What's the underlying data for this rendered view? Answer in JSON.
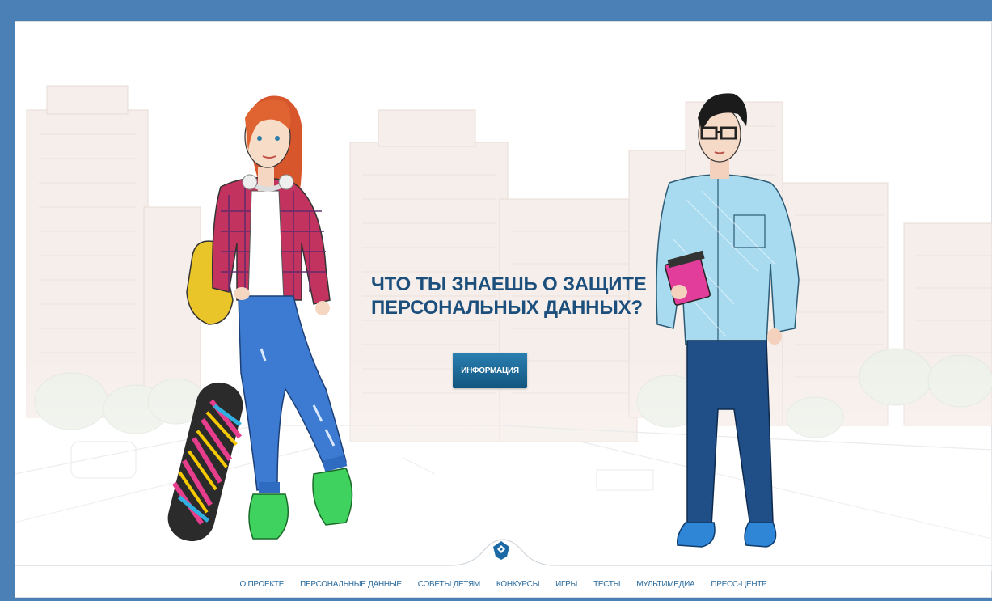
{
  "hero": {
    "title_line1": "ЧТО ТЫ ЗНАЕШЬ О ЗАЩИТЕ",
    "title_line2": "ПЕРСОНАЛЬНЫХ ДАННЫХ?",
    "button_label": "ИНФОРМАЦИЯ"
  },
  "nav": {
    "items": [
      {
        "label": "О ПРОЕКТЕ"
      },
      {
        "label": "ПЕРСОНАЛЬНЫЕ ДАННЫЕ"
      },
      {
        "label": "СОВЕТЫ ДЕТЯМ"
      },
      {
        "label": "КОНКУРСЫ"
      },
      {
        "label": "ИГРЫ"
      },
      {
        "label": "ТЕСТЫ"
      },
      {
        "label": "МУЛЬТИМЕДИА"
      },
      {
        "label": "ПРЕСС-ЦЕНТР"
      }
    ]
  },
  "colors": {
    "frame": "#4b80b7",
    "title": "#1c4f7c",
    "button": "#1a6796",
    "nav_link": "#2a6b9e"
  },
  "icons": {
    "logo": "rkn-shield-icon"
  }
}
